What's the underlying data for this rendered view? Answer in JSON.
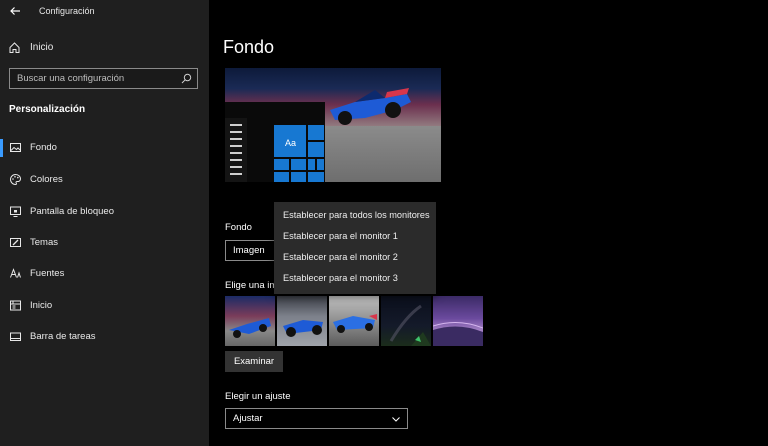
{
  "window": {
    "title": "Configuración"
  },
  "sidebar": {
    "home_label": "Inicio",
    "search_placeholder": "Buscar una configuración",
    "section_title": "Personalización",
    "items": [
      {
        "label": "Fondo",
        "icon": "image-icon",
        "active": true
      },
      {
        "label": "Colores",
        "icon": "palette-icon"
      },
      {
        "label": "Pantalla de bloqueo",
        "icon": "lock-screen-icon"
      },
      {
        "label": "Temas",
        "icon": "brush-icon"
      },
      {
        "label": "Fuentes",
        "icon": "font-icon"
      },
      {
        "label": "Inicio",
        "icon": "start-icon"
      },
      {
        "label": "Barra de tareas",
        "icon": "taskbar-icon"
      }
    ]
  },
  "main": {
    "title": "Fondo",
    "preview": {
      "tile_label": "Aa"
    },
    "background_label": "Fondo",
    "background_value": "Imagen",
    "choose_image_label": "Elige una imagen",
    "browse_label": "Examinar",
    "fit_label": "Elegir un ajuste",
    "fit_value": "Ajustar"
  },
  "context_menu": {
    "items": [
      "Establecer para todos los monitores",
      "Establecer para el monitor 1",
      "Establecer para el monitor 2",
      "Establecer para el monitor 3"
    ]
  },
  "colors": {
    "sidebar_bg": "#1f1f1f",
    "accent": "#3a9bff",
    "tile_blue": "#1778d2",
    "menu_bg": "#2b2b2b"
  }
}
